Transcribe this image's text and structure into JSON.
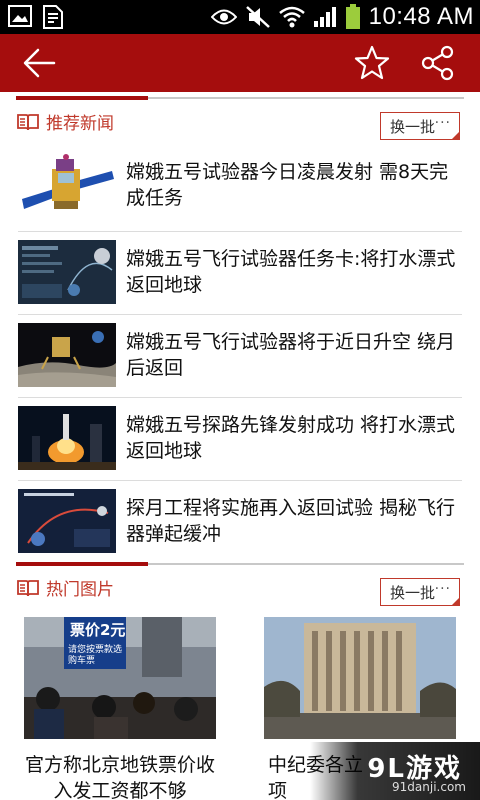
{
  "status_bar": {
    "time": "10:48 AM"
  },
  "recommend": {
    "title": "推荐新闻",
    "swap_label": "换一批",
    "swap_dots": "···",
    "items": [
      {
        "title": "嫦娥五号试验器今日凌晨发射 需8天完成任务"
      },
      {
        "title": "嫦娥五号飞行试验器任务卡:将打水漂式返回地球"
      },
      {
        "title": "嫦娥五号飞行试验器将于近日升空 绕月后返回"
      },
      {
        "title": "嫦娥五号探路先锋发射成功 将打水漂式返回地球"
      },
      {
        "title": "探月工程将实施再入返回试验 揭秘飞行器弹起缓冲"
      }
    ]
  },
  "hot_photos": {
    "title": "热门图片",
    "swap_label": "换一批",
    "swap_dots": "···",
    "items": [
      {
        "caption": "官方称北京地铁票价收入发工资都不够",
        "sign_price": "票价2元",
        "sign_ticket": "请您按票款选购车票"
      },
      {
        "caption": "中纪委各立项"
      }
    ]
  },
  "watermark": {
    "main": "9L游戏",
    "sub": "91danji.com"
  },
  "colors": {
    "brand": "#a50d0d",
    "accent_text": "#c0392b"
  }
}
